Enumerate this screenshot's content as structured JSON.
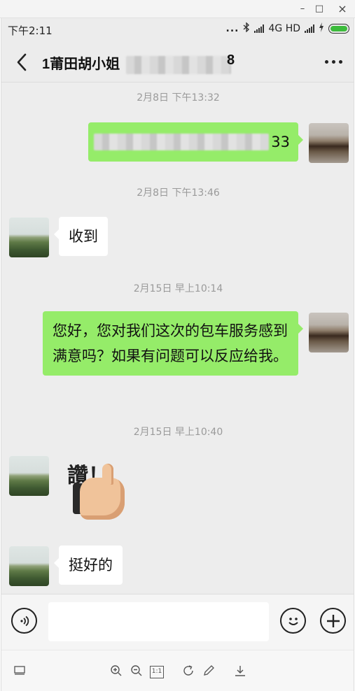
{
  "window": {
    "minimize_glyph": "–",
    "maximize_glyph": "□",
    "close_glyph": "×"
  },
  "status_bar": {
    "time": "下午2:11",
    "dots": "...",
    "network": "4G HD",
    "bluetooth_icon": "bluetooth-icon",
    "charging_icon": "lightning-icon"
  },
  "header": {
    "title_visible": "1莆田胡小姐",
    "title_tail": "8",
    "back_icon": "chevron-left-icon",
    "more_icon": "ellipsis-icon"
  },
  "messages": [
    {
      "type": "timestamp",
      "text": "2月8日 下午13:32"
    },
    {
      "type": "out",
      "text_visible": "33",
      "redacted": true
    },
    {
      "type": "timestamp",
      "text": "2月8日 下午13:46"
    },
    {
      "type": "in",
      "text": "收到"
    },
    {
      "type": "timestamp",
      "text": "2月15日 早上10:14"
    },
    {
      "type": "out",
      "text": "您好，您对我们这次的包车服务感到满意吗？如果有问题可以反应给我。"
    },
    {
      "type": "timestamp",
      "text": "2月15日 早上10:40"
    },
    {
      "type": "in_sticker",
      "sticker_text": "讚！"
    },
    {
      "type": "in",
      "text": "挺好的"
    }
  ],
  "input_bar": {
    "voice_icon": "voice-icon",
    "emoji_icon": "emoji-icon",
    "plus_icon": "plus-icon",
    "input_value": ""
  },
  "viewer_toolbar": {
    "ratio_label": "1:1",
    "icons": [
      "screen-icon",
      "zoom-in-icon",
      "zoom-out-icon",
      "actual-size-icon",
      "rotate-icon",
      "edit-icon",
      "download-icon"
    ]
  },
  "colors": {
    "out_bubble": "#95ec69",
    "in_bubble": "#ffffff",
    "chat_bg": "#ededed",
    "battery": "#3cbb3c"
  }
}
